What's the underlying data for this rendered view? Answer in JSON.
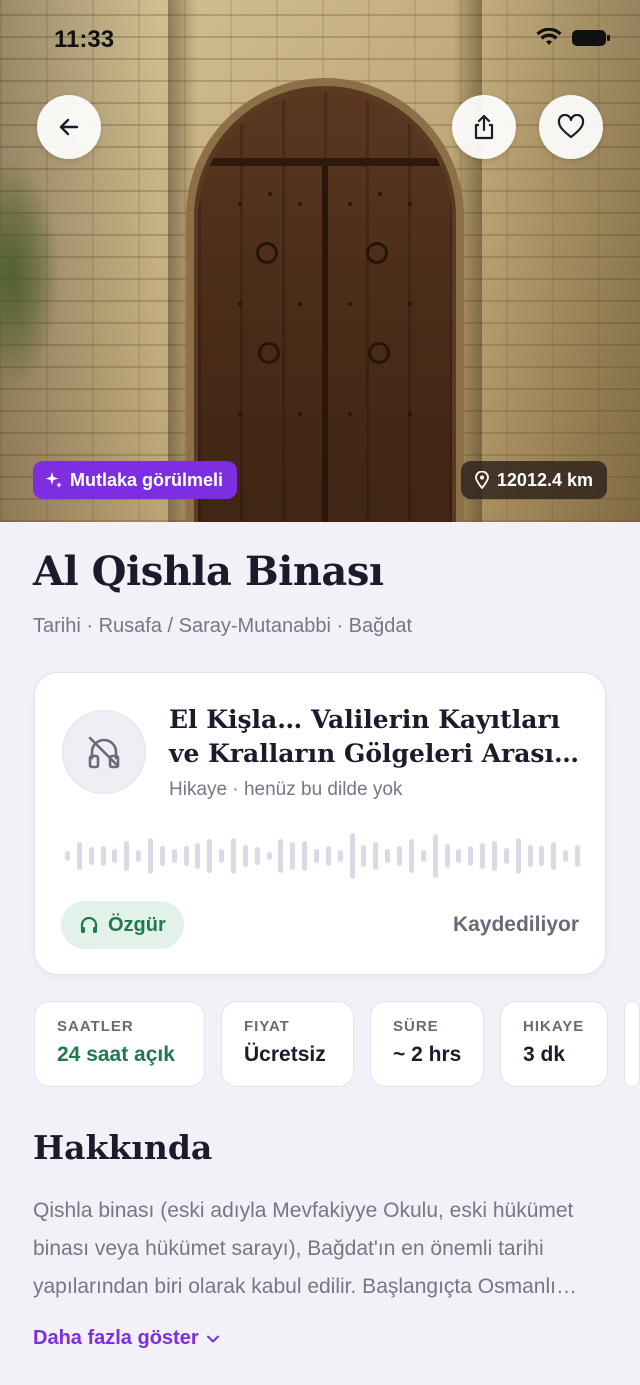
{
  "status_bar": {
    "time": "11:33"
  },
  "hero": {
    "badge_label": "Mutlaka görülmeli",
    "distance": "12012.4 km"
  },
  "place": {
    "title": "Al Qishla Binası",
    "subtitle": "Tarihi · Rusafa / Saray-Mutanabbi · Bağdat"
  },
  "audio": {
    "title": "El Kişla… Valilerin Kayıtları ve Kralların Gölgeleri Arası…",
    "meta": "Hikaye · henüz bu dilde yok",
    "chip_label": "Özgür",
    "status": "Kaydediliyor"
  },
  "stats": [
    {
      "label": "SAATLER",
      "value": "24 saat açık"
    },
    {
      "label": "FIYAT",
      "value": "Ücretsiz"
    },
    {
      "label": "SÜRE",
      "value": "~ 2 hrs"
    },
    {
      "label": "HIKAYE",
      "value": "3 dk"
    }
  ],
  "about": {
    "heading": "Hakkında",
    "text": "Qishla binası (eski adıyla Mevfakiyye Okulu, eski hükümet binası veya hükümet sarayı), Bağdat'ın en önemli tarihi yapılarından biri olarak kabul edilir. Başlangıçta Osmanlı döneminde askeri kışla olarak inşa edilmiştir.",
    "more_label": "Daha fazla göster"
  },
  "colors": {
    "accent": "#7c2ee0",
    "green": "#1f7a4c",
    "background": "#f3f1f8"
  },
  "icons": [
    "back-arrow-icon",
    "share-icon",
    "heart-icon",
    "sparkle-icon",
    "location-pin-icon",
    "headphones-off-icon",
    "headphones-icon",
    "chevron-down-icon"
  ]
}
